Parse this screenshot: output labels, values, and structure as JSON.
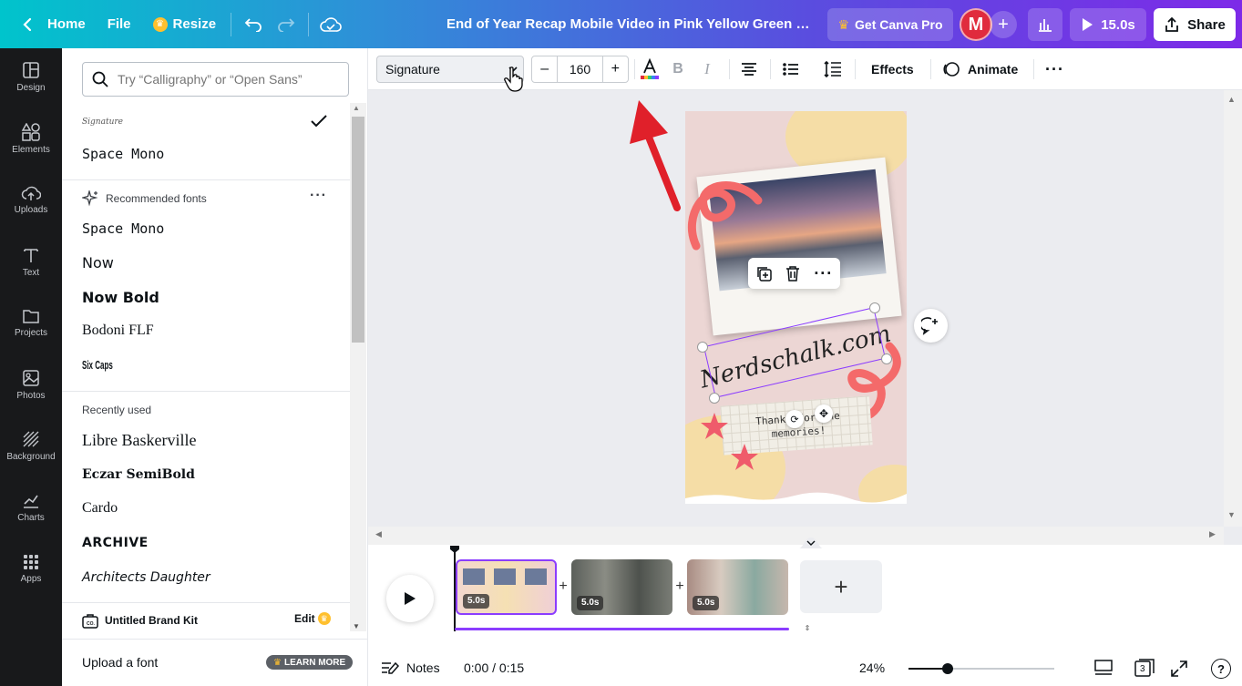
{
  "topbar": {
    "home": "Home",
    "file": "File",
    "resize": "Resize",
    "title": "End of Year Recap Mobile Video in Pink Yellow Green Refine...",
    "pro": "Get Canva Pro",
    "avatar_initial": "M",
    "add_member": "+",
    "duration": "15.0s",
    "share": "Share"
  },
  "rail": [
    {
      "label": "Design",
      "icon": "layout-icon"
    },
    {
      "label": "Elements",
      "icon": "shapes-icon"
    },
    {
      "label": "Uploads",
      "icon": "cloud-upload-icon"
    },
    {
      "label": "Text",
      "icon": "text-icon"
    },
    {
      "label": "Projects",
      "icon": "folder-icon"
    },
    {
      "label": "Photos",
      "icon": "image-icon"
    },
    {
      "label": "Background",
      "icon": "hatch-icon"
    },
    {
      "label": "Charts",
      "icon": "chart-icon"
    },
    {
      "label": "Apps",
      "icon": "grid-icon"
    }
  ],
  "font_panel": {
    "search_placeholder": "Try “Calligraphy” or “Open Sans”",
    "current_fonts": [
      "Signature",
      "Space Mono"
    ],
    "recommended_heading": "Recommended fonts",
    "recommended": [
      "Space Mono",
      "Now",
      "Now Bold",
      "Bodoni FLF",
      "Six Caps"
    ],
    "recently_heading": "Recently used",
    "recent": [
      "Libre Baskerville",
      "Eczar SemiBold",
      "Cardo",
      "ARCHIVE",
      "Architects Daughter"
    ],
    "brand_kit": "Untitled Brand Kit",
    "brand_edit": "Edit",
    "upload_font": "Upload a font",
    "learn_more": "LEARN MORE"
  },
  "toolbar": {
    "font_name": "Signature",
    "font_size": "160",
    "minus": "–",
    "plus": "+",
    "effects": "Effects",
    "animate": "Animate",
    "text_color": "#e02b3d"
  },
  "canvas": {
    "handwriting": "Nerdschalk.com",
    "note_text": "Thanks for the memories!"
  },
  "timeline": {
    "clips": [
      {
        "duration": "5.0s"
      },
      {
        "duration": "5.0s"
      },
      {
        "duration": "5.0s"
      }
    ],
    "add_page": "+"
  },
  "footer": {
    "notes": "Notes",
    "time": "0:00 / 0:15",
    "zoom": "24%",
    "zoom_level": 0.24,
    "pages": "3",
    "help": "?"
  },
  "colors": {
    "accent": "#8b3dff",
    "topbar_start": "#00c4cc",
    "topbar_end": "#7d2ae8",
    "annotation_arrow": "#e0202a"
  }
}
